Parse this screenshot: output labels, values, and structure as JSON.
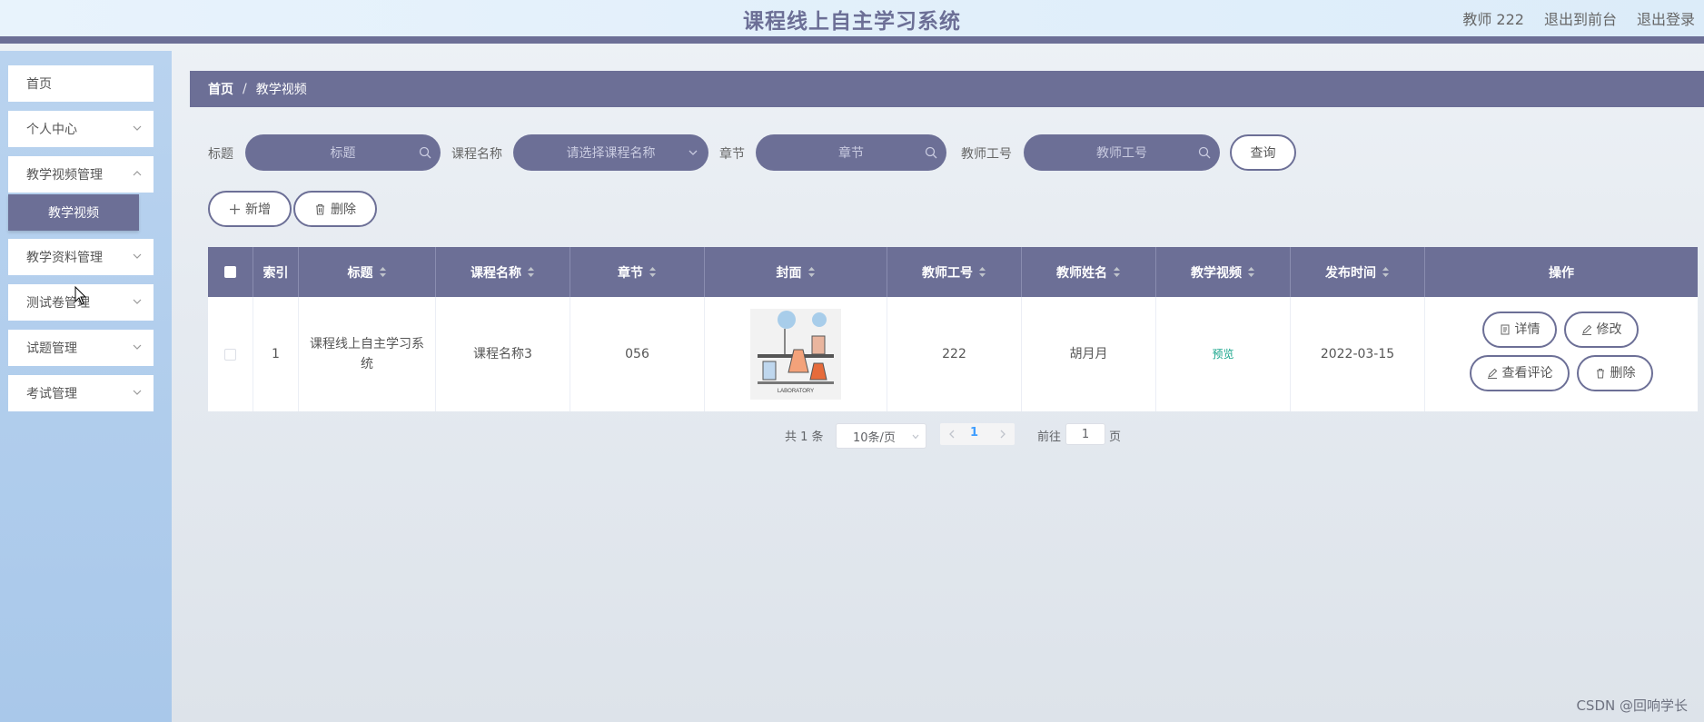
{
  "header": {
    "title": "课程线上自主学习系统",
    "user": "教师 222",
    "to_front": "退出到前台",
    "logout": "退出登录"
  },
  "sidebar": {
    "items": [
      {
        "label": "首页"
      },
      {
        "label": "个人中心"
      },
      {
        "label": "教学视频管理"
      },
      {
        "label": "教学资料管理"
      },
      {
        "label": "测试卷管理"
      },
      {
        "label": "试题管理"
      },
      {
        "label": "考试管理"
      }
    ],
    "active_sub": "教学视频"
  },
  "breadcrumb": {
    "home": "首页",
    "sep": "/",
    "current": "教学视频"
  },
  "filters": {
    "title_label": "标题",
    "title_placeholder": "标题",
    "course_label": "课程名称",
    "course_placeholder": "请选择课程名称",
    "chapter_label": "章节",
    "chapter_placeholder": "章节",
    "teacher_label": "教师工号",
    "teacher_placeholder": "教师工号",
    "query": "查询"
  },
  "actions": {
    "add": "新增",
    "delete": "删除"
  },
  "table": {
    "headers": [
      "索引",
      "标题",
      "课程名称",
      "章节",
      "封面",
      "教师工号",
      "教师姓名",
      "教学视频",
      "发布时间",
      "操作"
    ],
    "rows": [
      {
        "index": "1",
        "title": "课程线上自主学习系统",
        "course": "课程名称3",
        "chapter": "056",
        "cover_text": "LABORATORY",
        "teacher_id": "222",
        "teacher_name": "胡月月",
        "video": "预览",
        "date": "2022-03-15",
        "ops": {
          "detail": "详情",
          "edit": "修改",
          "comments": "查看评论",
          "delete": "删除"
        }
      }
    ]
  },
  "pagination": {
    "total": "共 1 条",
    "size": "10条/页",
    "current": "1",
    "goto": "前往",
    "goto_value": "1",
    "page_unit": "页"
  },
  "watermark": "CSDN @回响学长",
  "colors": {
    "primary": "#6c6f96",
    "accent": "#13a389",
    "sidebar": "#aecbeb"
  }
}
